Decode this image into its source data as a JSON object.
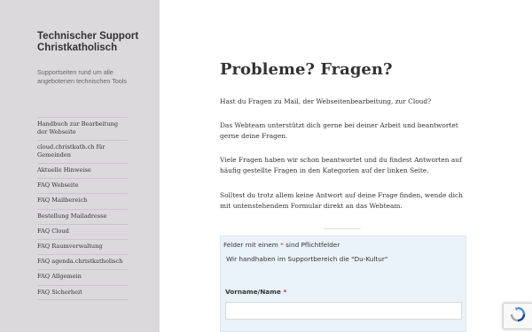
{
  "sidebar": {
    "site_title": "Technischer Support Christkatholisch",
    "site_description": "Supportseiten rund um alle angebotenen technischen Tools",
    "nav_items": [
      {
        "label": "Handbuch zur Bearbeitung der Webseite"
      },
      {
        "label": "cloud.christkath.ch für Gemeinden"
      },
      {
        "label": "Aktuelle Hinweise"
      },
      {
        "label": "FAQ Webseite"
      },
      {
        "label": "FAQ Mailbereich"
      },
      {
        "label": "Bestellung Mailadresse"
      },
      {
        "label": "FAQ Cloud"
      },
      {
        "label": "FAQ Raumverwaltung"
      },
      {
        "label": "FAQ agenda.christkatholisch"
      },
      {
        "label": "FAQ Allgemein"
      },
      {
        "label": "FAQ Sicherheit"
      }
    ]
  },
  "main": {
    "title": "Probleme? Fragen?",
    "paragraphs": [
      "Hast du Fragen zu Mail, der Webseitenbearbeitung, zur Cloud?",
      "Das Webteam unterstützt dich gerne bei deiner Arbeit und beantwortet gerne deine Fragen.",
      "Viele Fragen haben wir schon beantwortet und du findest Antworten auf häufig gestellte Fragen in den Kategorien auf der linken Seite.",
      "Solltest du trotz allem keine Antwort auf deine Frage finden, wende dich mit untenstehendem Formular direkt an das Webteam."
    ]
  },
  "form": {
    "required_note_pre": "Felder mit einem",
    "required_star": "*",
    "required_note_post": "sind Pflichtfelder",
    "du_note": "Wir handhaben im Supportbereich die \"Du-Kultur\"",
    "name_label": "Vorname/Name",
    "name_value": ""
  },
  "colors": {
    "sidebar_bg": "#dcd9dd",
    "form_bg": "#eaf2fa",
    "required_red": "#c0392b",
    "recaptcha_blue": "#4a90e2"
  },
  "icons": {
    "recaptcha": "recaptcha-icon"
  }
}
